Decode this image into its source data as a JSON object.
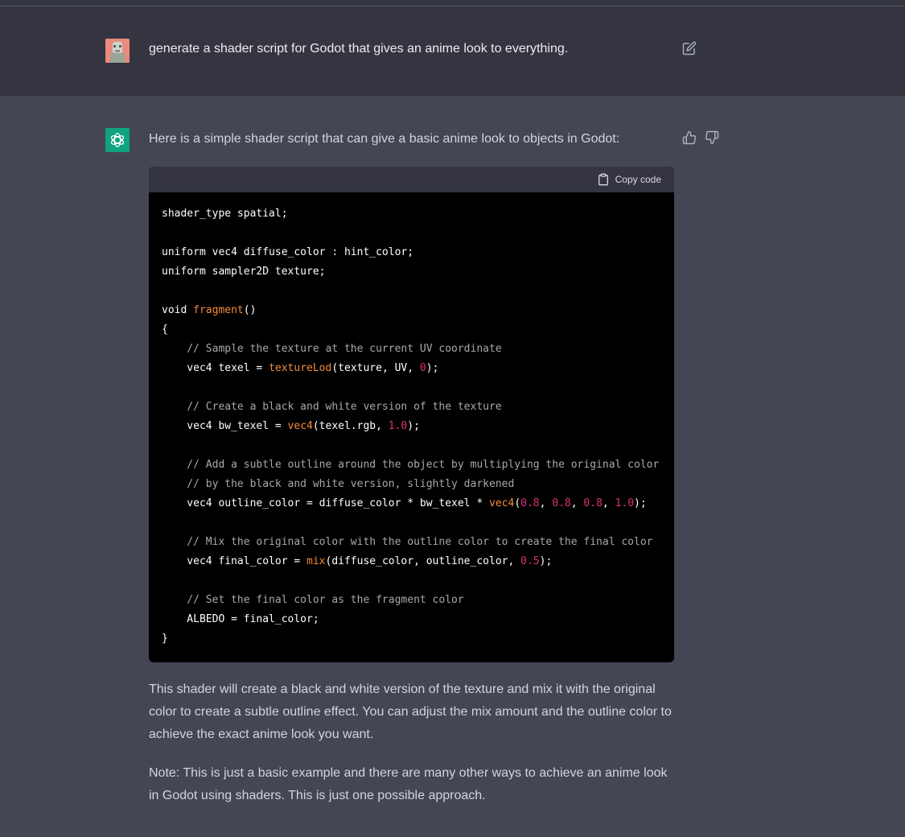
{
  "user_message": {
    "text": "generate a shader script for Godot that gives an anime look to everything."
  },
  "assistant": {
    "intro": "Here is a simple shader script that can give a basic anime look to objects in Godot:",
    "copy_label": "Copy code",
    "code_lines": [
      [
        {
          "t": "shader_type spatial;"
        }
      ],
      [],
      [
        {
          "t": "uniform vec4 diffuse_color : hint_color;"
        }
      ],
      [
        {
          "t": "uniform sampler2D texture;"
        }
      ],
      [],
      [
        {
          "t": "void "
        },
        {
          "t": "fragment",
          "c": "fn"
        },
        {
          "t": "()"
        }
      ],
      [
        {
          "t": "{"
        }
      ],
      [
        {
          "t": "    // Sample the texture at the current UV coordinate",
          "c": "com"
        }
      ],
      [
        {
          "t": "    vec4 texel = "
        },
        {
          "t": "textureLod",
          "c": "fn"
        },
        {
          "t": "(texture, UV, "
        },
        {
          "t": "0",
          "c": "num"
        },
        {
          "t": ");"
        }
      ],
      [],
      [
        {
          "t": "    // Create a black and white version of the texture",
          "c": "com"
        }
      ],
      [
        {
          "t": "    vec4 bw_texel = "
        },
        {
          "t": "vec4",
          "c": "fn"
        },
        {
          "t": "(texel.rgb, "
        },
        {
          "t": "1.0",
          "c": "num"
        },
        {
          "t": ");"
        }
      ],
      [],
      [
        {
          "t": "    // Add a subtle outline around the object by multiplying the original color",
          "c": "com"
        }
      ],
      [
        {
          "t": "    // by the black and white version, slightly darkened",
          "c": "com"
        }
      ],
      [
        {
          "t": "    vec4 outline_color = diffuse_color * bw_texel * "
        },
        {
          "t": "vec4",
          "c": "fn"
        },
        {
          "t": "("
        },
        {
          "t": "0.8",
          "c": "num"
        },
        {
          "t": ", "
        },
        {
          "t": "0.8",
          "c": "num"
        },
        {
          "t": ", "
        },
        {
          "t": "0.8",
          "c": "num"
        },
        {
          "t": ", "
        },
        {
          "t": "1.0",
          "c": "num"
        },
        {
          "t": ");"
        }
      ],
      [],
      [
        {
          "t": "    // Mix the original color with the outline color to create the final color",
          "c": "com"
        }
      ],
      [
        {
          "t": "    vec4 final_color = "
        },
        {
          "t": "mix",
          "c": "fn"
        },
        {
          "t": "(diffuse_color, outline_color, "
        },
        {
          "t": "0.5",
          "c": "num"
        },
        {
          "t": ");"
        }
      ],
      [],
      [
        {
          "t": "    // Set the final color as the fragment color",
          "c": "com"
        }
      ],
      [
        {
          "t": "    ALBEDO = final_color;"
        }
      ],
      [
        {
          "t": "}"
        }
      ]
    ],
    "paragraph_1": "This shader will create a black and white version of the texture and mix it with the original color to create a subtle outline effect. You can adjust the mix amount and the outline color to achieve the exact anime look you want.",
    "paragraph_2": "Note: This is just a basic example and there are many other ways to achieve an anime look in Godot using shaders. This is just one possible approach."
  },
  "icons": {
    "edit": "edit-icon",
    "thumbs_up": "thumbs-up-icon",
    "thumbs_down": "thumbs-down-icon",
    "copy": "clipboard-icon",
    "assistant_logo": "openai-logo-icon"
  },
  "colors": {
    "assistant_bg": "#444654",
    "user_bg": "#343541",
    "logo_bg": "#10a37f",
    "code_function": "#f28c3d",
    "code_number": "#df3079",
    "code_comment": "#a8a8a8"
  }
}
